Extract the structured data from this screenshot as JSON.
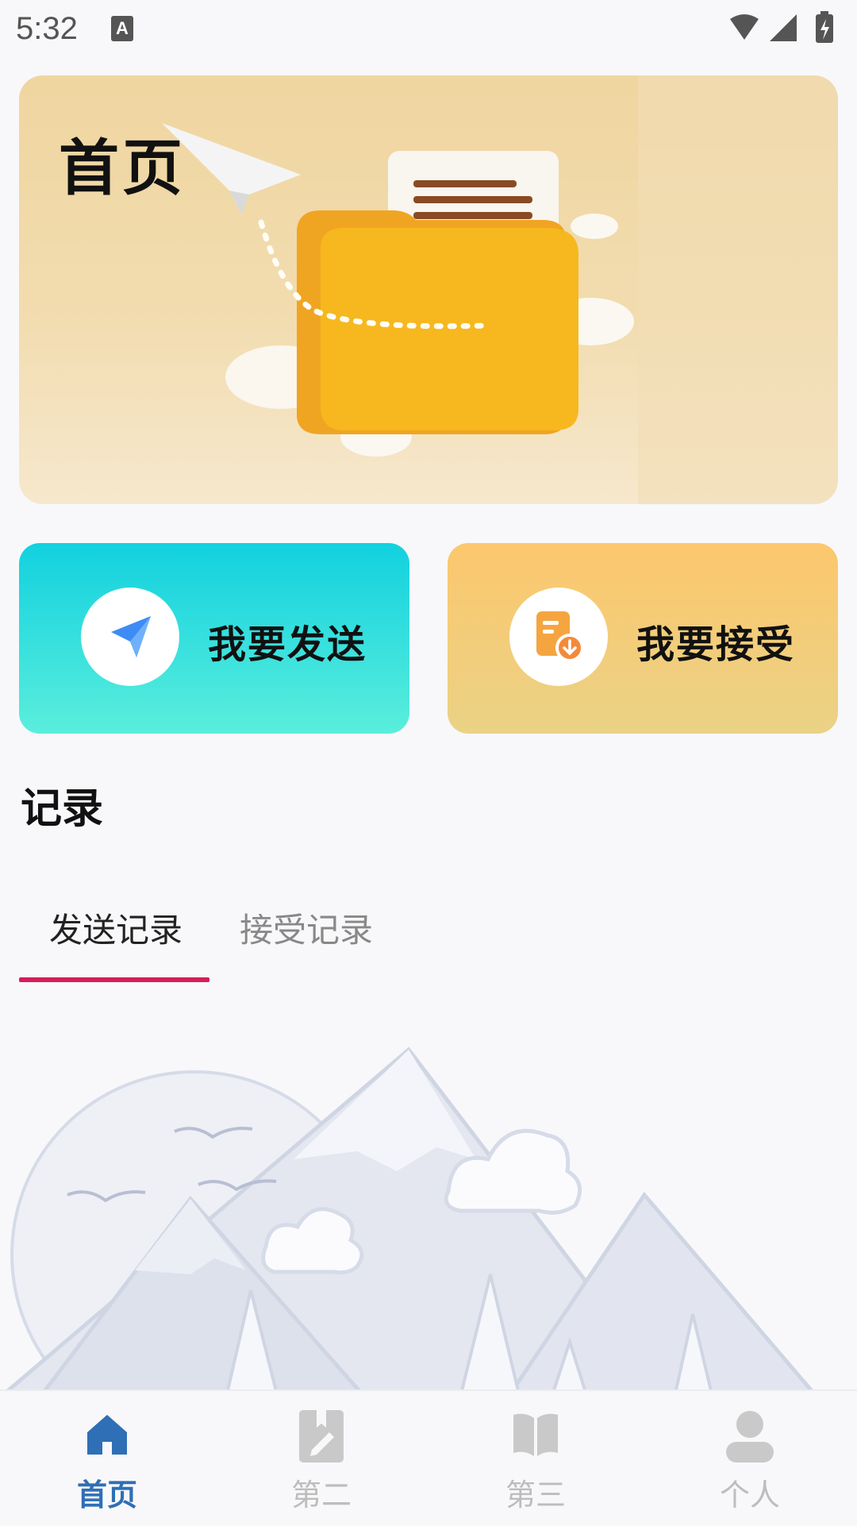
{
  "status": {
    "time": "5:32",
    "notification_glyph": "A"
  },
  "banner": {
    "title": "首页"
  },
  "actions": {
    "send_label": "我要发送",
    "receive_label": "我要接受"
  },
  "records": {
    "title": "记录",
    "tabs": [
      {
        "label": "发送记录",
        "active": true
      },
      {
        "label": "接受记录",
        "active": false
      }
    ]
  },
  "nav": {
    "items": [
      {
        "label": "首页",
        "icon": "home-icon",
        "active": true
      },
      {
        "label": "第二",
        "icon": "edit-document-icon",
        "active": false
      },
      {
        "label": "第三",
        "icon": "book-icon",
        "active": false
      },
      {
        "label": "个人",
        "icon": "person-icon",
        "active": false
      }
    ]
  },
  "colors": {
    "accent": "#2f6fb5",
    "tab_indicator": "#d81b5a",
    "send_card": "#12d1df",
    "receive_card": "#fcc76d"
  }
}
